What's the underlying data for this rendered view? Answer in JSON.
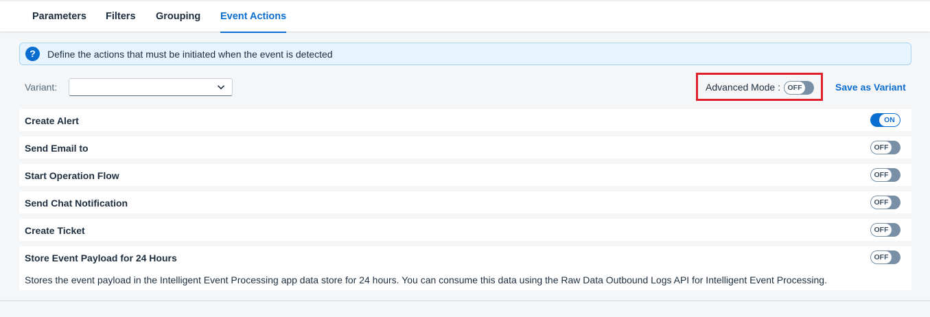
{
  "tabs": [
    {
      "label": "Parameters",
      "active": false
    },
    {
      "label": "Filters",
      "active": false
    },
    {
      "label": "Grouping",
      "active": false
    },
    {
      "label": "Event Actions",
      "active": true
    }
  ],
  "info": {
    "icon": "question-icon",
    "icon_glyph": "?",
    "text": "Define the actions that must be initiated when the event is detected"
  },
  "variant": {
    "label": "Variant:",
    "value": "",
    "icon": "chevron-down-icon"
  },
  "advanced_mode": {
    "label": "Advanced Mode :",
    "state": "OFF"
  },
  "save_as_variant": "Save as Variant",
  "actions": [
    {
      "label": "Create Alert",
      "state": "ON"
    },
    {
      "label": "Send Email to",
      "state": "OFF"
    },
    {
      "label": "Start Operation Flow",
      "state": "OFF"
    },
    {
      "label": "Send Chat Notification",
      "state": "OFF"
    },
    {
      "label": "Create Ticket",
      "state": "OFF"
    },
    {
      "label": "Store Event Payload for 24 Hours",
      "state": "OFF",
      "description": "Stores the event payload in the Intelligent Event Processing app data store for 24 hours. You can consume this data using the Raw Data Outbound Logs API for Intelligent Event Processing."
    }
  ],
  "colors": {
    "accent": "#0a6ed1",
    "highlight_border": "#e0202a",
    "info_background": "#e5f4fe",
    "switch_off": "#788fa6"
  }
}
